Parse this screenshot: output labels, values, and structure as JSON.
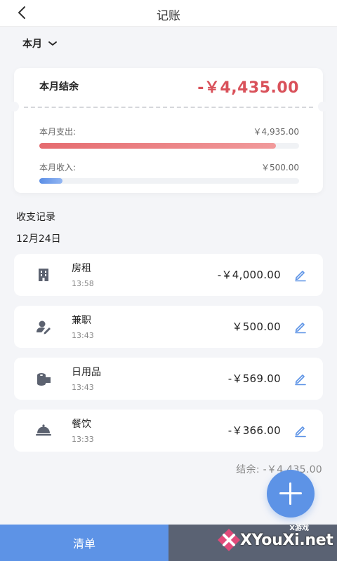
{
  "header": {
    "title": "记账",
    "back_icon": "chevron-left-icon"
  },
  "period": {
    "label": "本月",
    "icon": "chevron-down-icon"
  },
  "summary": {
    "label": "本月结余",
    "amount": "-￥4,435.00",
    "amount_color": "#d9515a",
    "expense_label": "本月支出:",
    "expense_value": "￥4,935.00",
    "expense_ratio": 0.91,
    "income_label": "本月收入:",
    "income_value": "￥500.00",
    "income_ratio": 0.09
  },
  "records": {
    "section_title": "收支记录",
    "date": "12月24日",
    "items": [
      {
        "name": "房租",
        "time": "13:58",
        "amount": "-￥4,000.00",
        "icon": "building-icon"
      },
      {
        "name": "兼职",
        "time": "13:43",
        "amount": "￥500.00",
        "icon": "person-edit-icon"
      },
      {
        "name": "日用品",
        "time": "13:43",
        "amount": "-￥569.00",
        "icon": "toilet-paper-icon"
      },
      {
        "name": "餐饮",
        "time": "13:33",
        "amount": "-￥366.00",
        "icon": "food-cloche-icon"
      }
    ],
    "balance": "结余: -￥4,435.00"
  },
  "fab": {
    "icon": "plus-icon"
  },
  "tabs": {
    "list_label": "清单"
  },
  "watermark": {
    "text": "XYouXi.net",
    "tag": "X游戏"
  },
  "colors": {
    "accent": "#5d93e6",
    "expense_bar": "#e56b6f",
    "income_bar": "#5b8ee6",
    "dark_tab": "#5a6273"
  }
}
